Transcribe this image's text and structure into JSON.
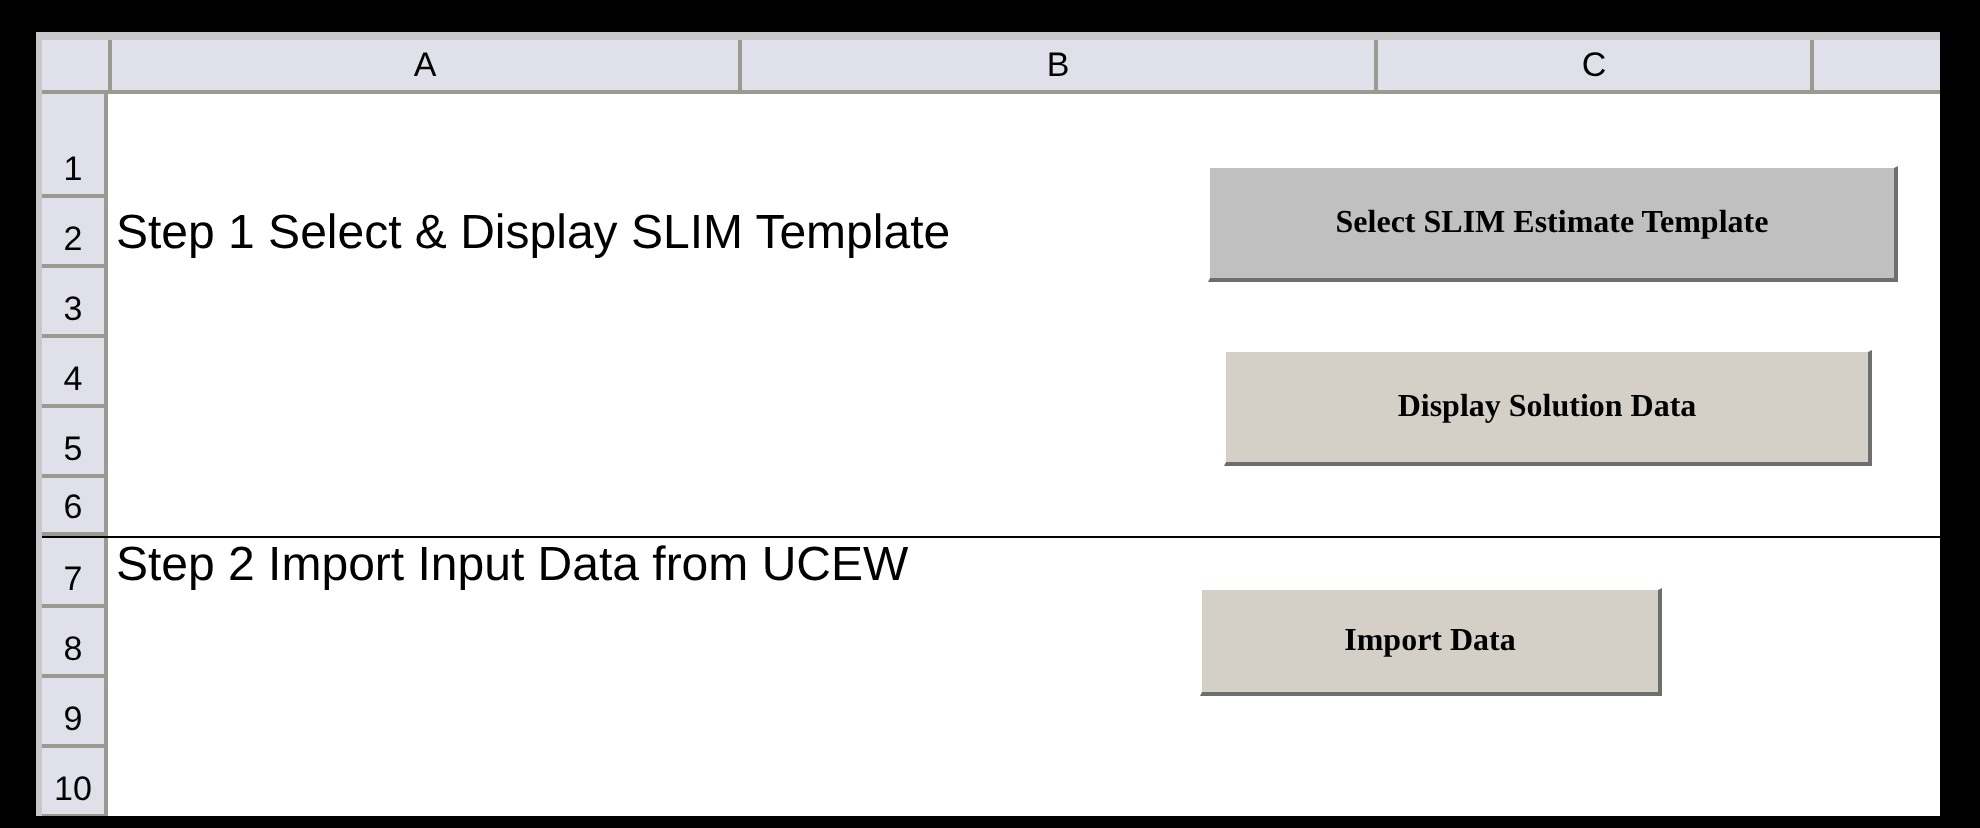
{
  "columns": [
    "A",
    "B",
    "C"
  ],
  "rows": [
    {
      "number": "1"
    },
    {
      "number": "2",
      "cells": [
        "Step 1 Select & Display SLIM Template"
      ]
    },
    {
      "number": "3"
    },
    {
      "number": "4"
    },
    {
      "number": "5"
    },
    {
      "number": "6"
    },
    {
      "number": "7",
      "cells": [
        "Step 2 Import Input Data  from UCEW"
      ]
    },
    {
      "number": "8"
    },
    {
      "number": "9"
    },
    {
      "number": "10"
    }
  ],
  "buttons": [
    {
      "label": "Select SLIM Estimate Template",
      "kind": "grey"
    },
    {
      "label": "Display Solution Data",
      "kind": "beige"
    },
    {
      "label": "Import Data",
      "kind": "beige"
    }
  ]
}
